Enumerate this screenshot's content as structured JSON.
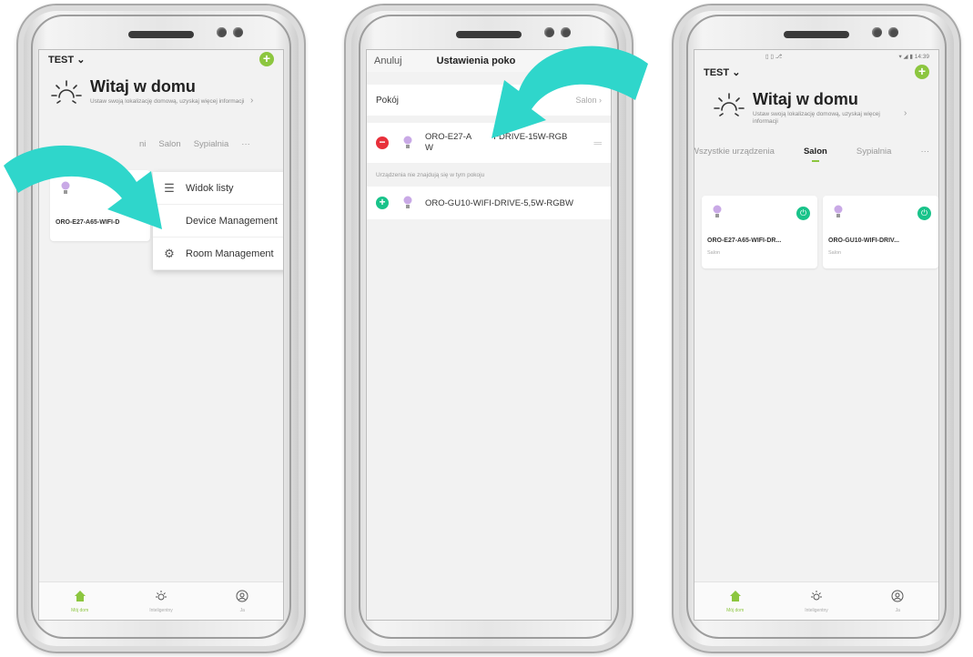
{
  "colors": {
    "accent_green": "#8cc63f",
    "device_green": "#19c38a",
    "remove_red": "#e8303b",
    "arrow_teal": "#2fd6cb"
  },
  "phone1": {
    "home_name": "TEST",
    "welcome_title": "Witaj w domu",
    "welcome_sub": "Ustaw swoją lokalizację domową, uzyskaj więcej informacji",
    "tabs": [
      "ni",
      "Salon",
      "Sypialnia",
      "···"
    ],
    "device_name": "ORO-E27-A65-WIFI-D",
    "menu": [
      {
        "icon": "list-icon",
        "label": "Widok listy"
      },
      {
        "icon": "device-icon",
        "label": "Device Management"
      },
      {
        "icon": "gear-icon",
        "label": "Room Management"
      }
    ],
    "nav": [
      {
        "icon": "home-icon",
        "label": "Mój dom"
      },
      {
        "icon": "sun-icon",
        "label": "Inteligentny"
      },
      {
        "icon": "user-icon",
        "label": "Ja"
      }
    ]
  },
  "phone2": {
    "cancel": "Anuluj",
    "title": "Ustawienia poko",
    "room_label": "Pokój",
    "room_value": "Salon",
    "device_in_room_a": "ORO-E27-A",
    "device_in_room_b": "FDRIVE-15W-RGB",
    "device_in_room_c": "W",
    "section_label": "Urządzenia nie znajdują się w tym pokoju",
    "device_outside": "ORO-GU10-WIFI-DRIVE-5,5W-RGBW"
  },
  "phone3": {
    "home_name": "TEST",
    "status_time": "14:39",
    "welcome_title": "Witaj w domu",
    "welcome_sub": "Ustaw swoją lokalizację domową, uzyskaj więcej informacji",
    "tabs": [
      "Wszystkie urządzenia",
      "Salon",
      "Sypialnia",
      "···"
    ],
    "devices": [
      {
        "name": "ORO-E27-A65-WIFI-DR...",
        "room": "Salon"
      },
      {
        "name": "ORO-GU10-WIFI-DRIV...",
        "room": "Salon"
      }
    ],
    "nav": [
      {
        "icon": "home-icon",
        "label": "Mój dom"
      },
      {
        "icon": "sun-icon",
        "label": "Inteligentny"
      },
      {
        "icon": "user-icon",
        "label": "Ja"
      }
    ]
  }
}
